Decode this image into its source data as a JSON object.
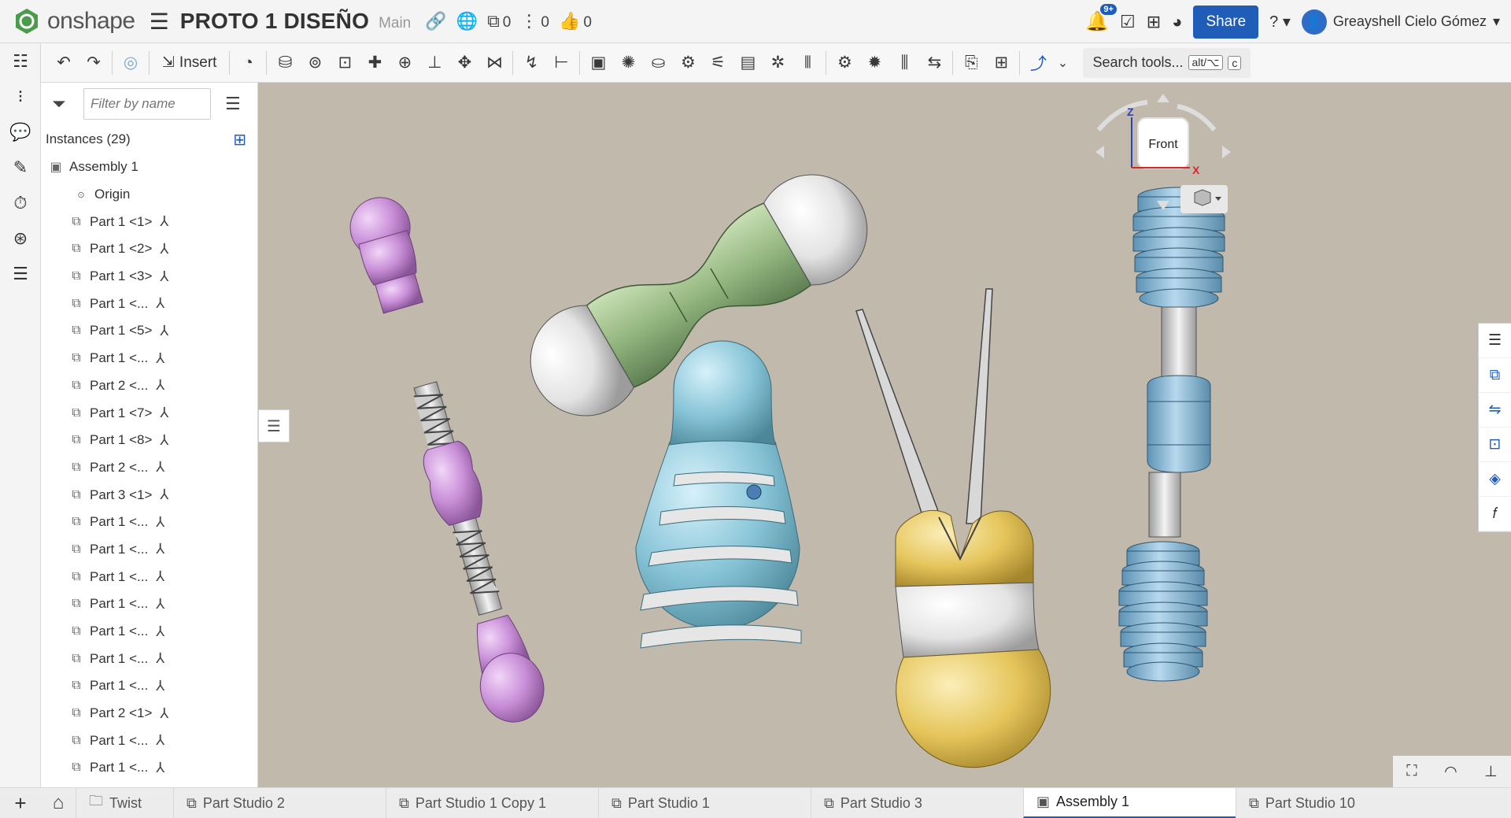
{
  "header": {
    "logo_text": "onshape",
    "doc_title": "PROTO 1 DISEÑO",
    "branch": "Main",
    "copies_count": "0",
    "versions_count": "0",
    "likes_count": "0",
    "notifications_badge": "9+",
    "share_label": "Share",
    "help_label": "?",
    "user_name": "Greayshell Cielo Gómez"
  },
  "toolbar": {
    "insert_label": "Insert",
    "search_label": "Search tools...",
    "search_key1": "alt/⌥",
    "search_key2": "c"
  },
  "panel": {
    "filter_placeholder": "Filter by name",
    "instances_header": "Instances (29)",
    "assembly_label": "Assembly 1",
    "origin_label": "Origin",
    "items": [
      "Part 1 <1>",
      "Part 1 <2>",
      "Part 1 <3>",
      "Part 1 <...",
      "Part 1 <5>",
      "Part 1 <...",
      "Part 2 <...",
      "Part 1 <7>",
      "Part 1 <8>",
      "Part 2 <...",
      "Part 3 <1>",
      "Part 1 <...",
      "Part 1 <...",
      "Part 1 <...",
      "Part 1 <...",
      "Part 1 <...",
      "Part 1 <...",
      "Part 1 <...",
      "Part 2 <1>",
      "Part 1 <...",
      "Part 1 <..."
    ]
  },
  "viewcube": {
    "face": "Front",
    "axis_z": "Z",
    "axis_x": "X"
  },
  "tabs": [
    {
      "label": "Twist"
    },
    {
      "label": "Part Studio 2"
    },
    {
      "label": "Part Studio 1 Copy 1"
    },
    {
      "label": "Part Studio 1"
    },
    {
      "label": "Part Studio 3"
    },
    {
      "label": "Assembly 1"
    },
    {
      "label": "Part Studio 10"
    }
  ],
  "colors": {
    "accent": "#1f5db8",
    "viewport_bg": "#c0b9ac",
    "purple": "#c58fd4",
    "green": "#8fb07c",
    "blue": "#7bb6cc",
    "yellow": "#e2c25a",
    "gray": "#e6e6e6"
  }
}
